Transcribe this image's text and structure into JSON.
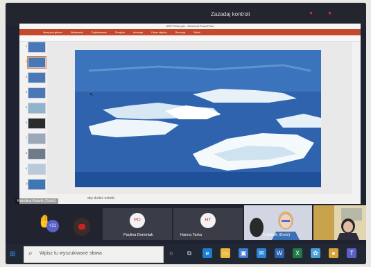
{
  "top_bar": {
    "title": "Zazadaj kontroli"
  },
  "powerpoint": {
    "title": "ARKTYKA.pptx - Microsoft PowerPoint",
    "tabs": [
      "Narzędzia główne",
      "Wstawianie",
      "Projektowanie",
      "Przejścia",
      "Animacje",
      "Pokaz slajdów",
      "Recenzja",
      "Widok"
    ],
    "slide_numbers": [
      "1",
      "2",
      "3",
      "4",
      "5",
      "6",
      "7",
      "8",
      "9",
      "10",
      "11"
    ],
    "notes_placeholder": "aby dodać notatki"
  },
  "call": {
    "presenter_label": "Karolina Kulwik (Gość)",
    "raised_hands_count": "+21",
    "participants": [
      {
        "initials": "PD",
        "name": "Paulina Dominiak"
      },
      {
        "initials": "HT",
        "name": "Hanna Tarka"
      }
    ],
    "camera_label": "k Kulwik (Gość)"
  },
  "taskbar": {
    "search_placeholder": "Wpisz tu wyszukiwane słowa",
    "apps": [
      "cortana",
      "task-view",
      "edge",
      "file-explorer",
      "store",
      "mail",
      "word",
      "excel",
      "photos",
      "chrome",
      "teams"
    ]
  },
  "colors": {
    "ribbon": "#c54a2b",
    "teams_bar": "#21242e",
    "taskbar": "#222833"
  }
}
